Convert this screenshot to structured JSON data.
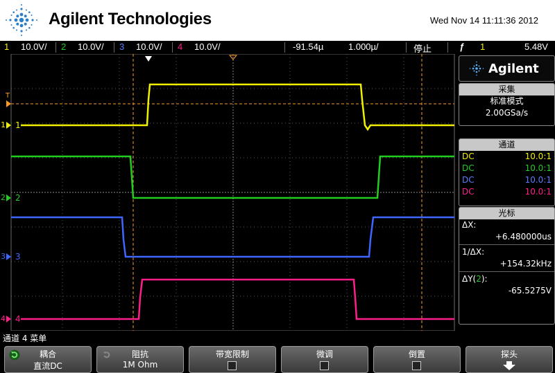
{
  "header": {
    "brand": "Agilent Technologies",
    "datetime": "Wed Nov 14 11:11:36 2012"
  },
  "status": {
    "ch1_num": "1",
    "ch1_scale": "10.0V/",
    "ch2_num": "2",
    "ch2_scale": "10.0V/",
    "ch3_num": "3",
    "ch3_scale": "10.0V/",
    "ch4_num": "4",
    "ch4_scale": "10.0V/",
    "delay": "-91.54µ",
    "timebase": "1.000µ/",
    "run_state": "停止",
    "trig_icon": "ƒ",
    "trig_source": "1",
    "trig_level": "5.48V"
  },
  "markers": {
    "t": "T",
    "ch1": "1",
    "ch2": "2",
    "ch3": "3",
    "ch4": "4"
  },
  "colors": {
    "ch1": "#f0f000",
    "ch2": "#22cc22",
    "ch3": "#3f66ff",
    "ch4": "#ff1f8a",
    "trigger": "#ff9a2a"
  },
  "side": {
    "brand": "Agilent",
    "acq": {
      "title": "采集",
      "mode": "标准模式",
      "rate": "2.00GSa/s"
    },
    "channels": {
      "title": "通道",
      "rows": [
        {
          "coupling": "DC",
          "ratio": "10.0:1"
        },
        {
          "coupling": "DC",
          "ratio": "10.0:1"
        },
        {
          "coupling": "DC",
          "ratio": "10.0:1"
        },
        {
          "coupling": "DC",
          "ratio": "10.0:1"
        }
      ]
    },
    "cursors": {
      "title": "光标",
      "dx_label": "ΔX:",
      "dx_value": "+6.480000us",
      "inv_label": "1/ΔX:",
      "inv_value": "+154.32kHz",
      "dy_label_a": "ΔY(",
      "dy_label_ch": "2",
      "dy_label_b": "):",
      "dy_value": "-65.5275V"
    }
  },
  "menu": {
    "title": "通道 4 菜单"
  },
  "softkeys": [
    {
      "title": "耦合",
      "value": "直流DC"
    },
    {
      "title": "阻抗",
      "value": "1M Ohm"
    },
    {
      "title": "带宽限制",
      "value": ""
    },
    {
      "title": "微调",
      "value": ""
    },
    {
      "title": "倒置",
      "value": ""
    },
    {
      "title": "探头",
      "value": ""
    }
  ]
}
